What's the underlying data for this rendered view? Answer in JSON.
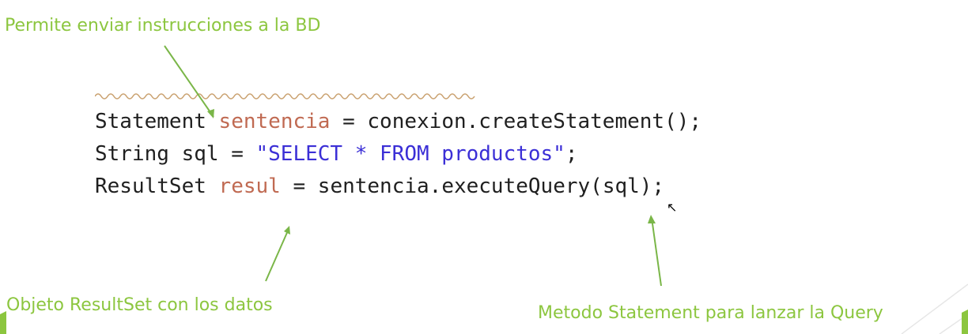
{
  "annotations": {
    "top": "Permite enviar instrucciones a la BD",
    "bottom_left": "Objeto ResultSet con los datos",
    "bottom_right": "Metodo Statement para lanzar la Query"
  },
  "code": {
    "line1": {
      "type": "Statement",
      "var": "sentencia",
      "rest": " = conexion.createStatement();"
    },
    "line2": {
      "type": "String",
      "rest1": " sql = ",
      "string": "\"SELECT * FROM productos\"",
      "rest2": ";"
    },
    "line3": {
      "type": "ResultSet",
      "var": "resul",
      "rest": " = sentencia.executeQuery(sql);"
    }
  },
  "colors": {
    "annotation": "#8cc63f",
    "arrow": "#7ab648",
    "variable": "#c06a52",
    "string": "#3b2fd6"
  },
  "icons": [
    "mouse-cursor-icon",
    "slide-corner-decoration"
  ]
}
